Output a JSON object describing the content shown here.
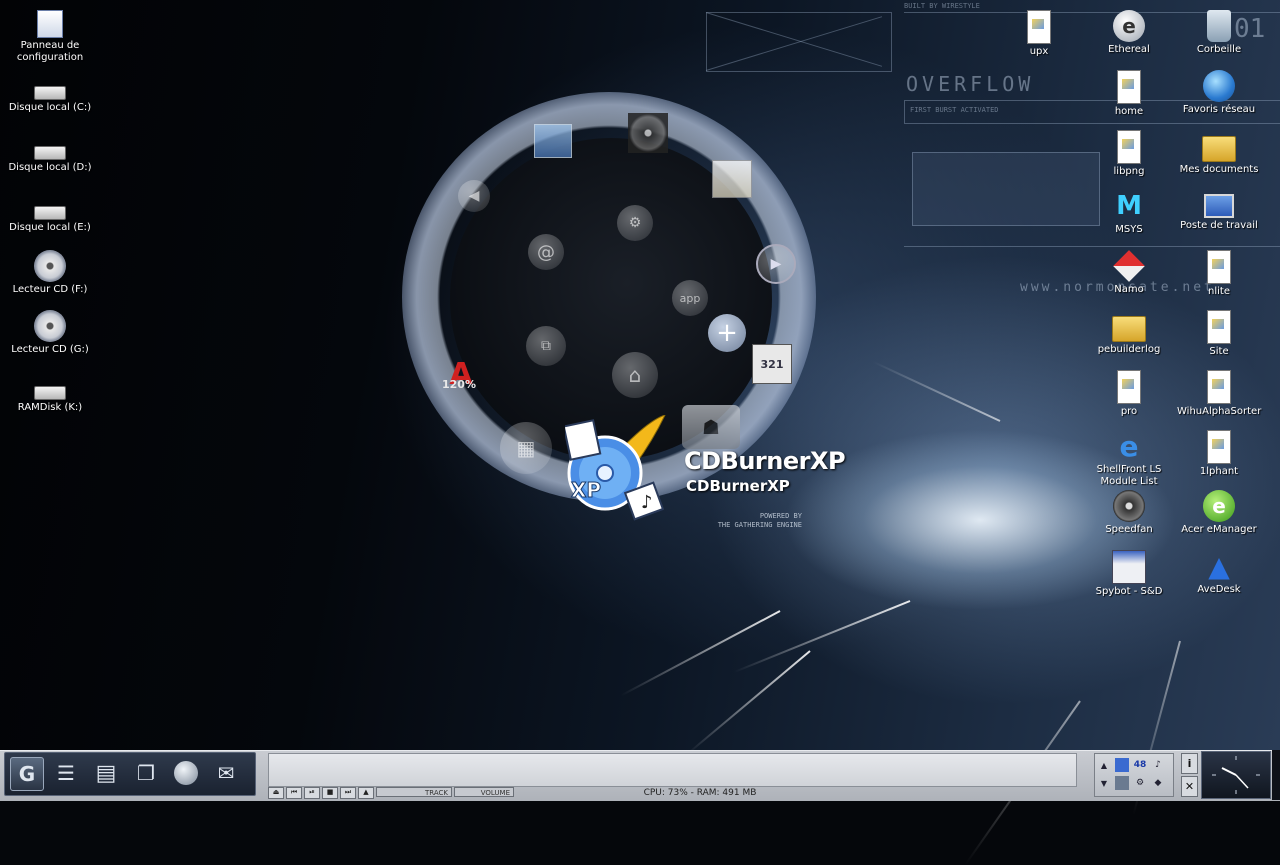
{
  "wallpaper": {
    "brand_text": "OVERFLOW",
    "built_by": "BUILT BY WIRESTYLE",
    "status_line": "FIRST BURST ACTIVATED",
    "url": "www.normonsate.net",
    "big_number": "01"
  },
  "desktop_left": [
    {
      "label": "Panneau de configuration",
      "icon": "control-panel-icon"
    },
    {
      "label": "Disque local (C:)",
      "icon": "hard-drive-icon"
    },
    {
      "label": "Disque local (D:)",
      "icon": "hard-drive-icon"
    },
    {
      "label": "Disque local (E:)",
      "icon": "hard-drive-icon"
    },
    {
      "label": "Lecteur CD (F:)",
      "icon": "cd-drive-icon"
    },
    {
      "label": "Lecteur CD (G:)",
      "icon": "cd-drive-icon"
    },
    {
      "label": "RAMDisk (K:)",
      "icon": "hard-drive-icon"
    }
  ],
  "desktop_right": [
    {
      "label": "upx",
      "icon": "document-icon"
    },
    {
      "label": "Ethereal",
      "icon": "ethereal-icon"
    },
    {
      "label": "Corbeille",
      "icon": "recycle-bin-icon"
    },
    {
      "label": "home",
      "icon": "document-icon"
    },
    {
      "label": "Favoris réseau",
      "icon": "network-places-icon"
    },
    {
      "label": "libpng",
      "icon": "document-icon"
    },
    {
      "label": "Mes documents",
      "icon": "my-documents-icon"
    },
    {
      "label": "MSYS",
      "icon": "msys-icon"
    },
    {
      "label": "Poste de travail",
      "icon": "my-computer-icon"
    },
    {
      "label": "Namo",
      "icon": "namo-icon"
    },
    {
      "label": "nlite",
      "icon": "document-icon"
    },
    {
      "label": "pebuilderlog",
      "icon": "archive-icon"
    },
    {
      "label": "Site",
      "icon": "document-icon"
    },
    {
      "label": "pro",
      "icon": "document-icon"
    },
    {
      "label": "WihuAlphaSorter",
      "icon": "document-icon"
    },
    {
      "label": "ShellFront LS Module List",
      "icon": "internet-explorer-icon"
    },
    {
      "label": "1lphant",
      "icon": "document-icon"
    },
    {
      "label": "Speedfan",
      "icon": "fan-icon"
    },
    {
      "label": "Acer eManager",
      "icon": "acer-emanager-icon"
    },
    {
      "label": "Spybot - S&D",
      "icon": "spybot-icon"
    },
    {
      "label": "AveDesk",
      "icon": "avedesk-icon"
    }
  ],
  "launcher": {
    "selected_title": "CDBurnerXP",
    "selected_subtitle": "CDBurnerXP",
    "badge_text": "XP",
    "powered_by": "POWERED BY",
    "engine": "THE GATHERING ENGINE",
    "ring_items": [
      {
        "icon": "display-settings-icon"
      },
      {
        "icon": "fan-icon"
      },
      {
        "icon": "notepad-icon"
      },
      {
        "icon": "volume-icon"
      },
      {
        "icon": "play-icon"
      },
      {
        "icon": "at-sign-icon",
        "glyph": "@"
      },
      {
        "icon": "settings-gears-icon"
      },
      {
        "icon": "app-icon",
        "glyph": "app"
      },
      {
        "icon": "add-icon",
        "glyph": "+"
      },
      {
        "icon": "network-icon"
      },
      {
        "icon": "home-icon"
      },
      {
        "icon": "clapper-icon",
        "glyph": "321"
      },
      {
        "icon": "acrobat-icon",
        "glyph": "120%"
      },
      {
        "icon": "calculator-icon"
      },
      {
        "icon": "alien-icon"
      }
    ]
  },
  "taskbar": {
    "launchers": [
      {
        "icon": "start-g-icon",
        "glyph": "G"
      },
      {
        "icon": "list-menu-icon"
      },
      {
        "icon": "book-icon"
      },
      {
        "icon": "network-computers-icon"
      },
      {
        "icon": "globe-icon"
      },
      {
        "icon": "mail-tray-icon"
      }
    ],
    "media_controls": [
      "⏏",
      "⏮",
      "⏯",
      "■",
      "⏭",
      "▲"
    ],
    "track_label": "TRACK",
    "volume_label": "VOLUME",
    "status": "CPU: 73% - RAM: 491 MB",
    "tray_number": "48",
    "info_button": "i",
    "close_button": "✕"
  }
}
